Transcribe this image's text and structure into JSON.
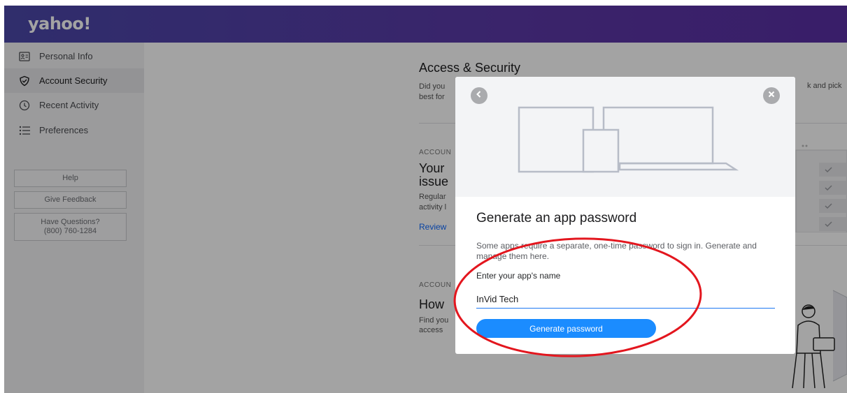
{
  "header": {
    "logo_text": "yahoo!"
  },
  "sidebar": {
    "items": [
      {
        "label": "Personal Info",
        "icon": "id-card-icon"
      },
      {
        "label": "Account Security",
        "icon": "shield-icon",
        "active": true
      },
      {
        "label": "Recent Activity",
        "icon": "clock-icon"
      },
      {
        "label": "Preferences",
        "icon": "list-icon"
      }
    ],
    "help_label": "Help",
    "feedback_label": "Give Feedback",
    "questions_label": "Have Questions?",
    "phone": "(800) 760-1284"
  },
  "main": {
    "title": "Access & Security",
    "desc_left": "Did you best for",
    "desc_right": "k and pick",
    "card1": {
      "kicker": "ACCOUN",
      "title_line1": "Your",
      "title_line2": "issue",
      "desc_line1": "Regular",
      "desc_line2": "activity l",
      "link": "Review"
    },
    "card2": {
      "kicker": "ACCOUN",
      "title": "How",
      "desc_line1": "Find you",
      "desc_line2": "access"
    }
  },
  "modal": {
    "title": "Generate an app password",
    "description": "Some apps require a separate, one-time password to sign in. Generate and manage them here.",
    "input_label": "Enter your app's name",
    "input_value": "InVid Tech",
    "button_label": "Generate password"
  },
  "colors": {
    "header_gradient_start": "#4b48a9",
    "header_gradient_end": "#5a2fa4",
    "primary_button": "#1b8cff",
    "annotation_ring": "#e3161e"
  }
}
